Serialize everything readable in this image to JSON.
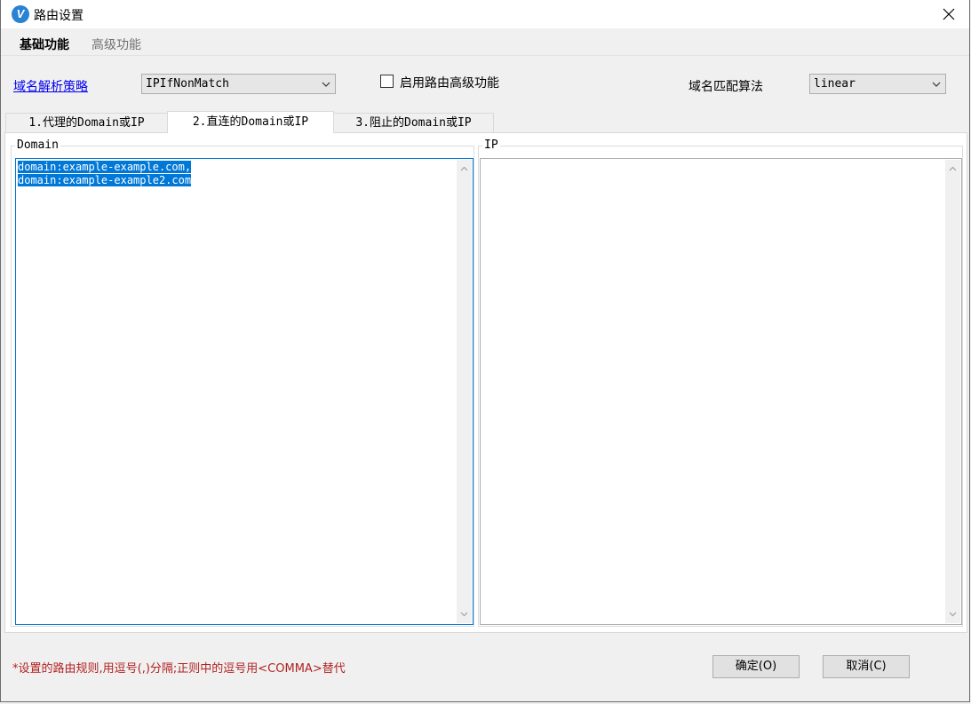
{
  "window": {
    "title": "路由设置",
    "app_icon_letter": "V"
  },
  "menu": {
    "items": [
      {
        "label": "基础功能"
      },
      {
        "label": "高级功能"
      }
    ]
  },
  "options": {
    "domain_strategy_link": "域名解析策略",
    "domain_strategy_value": "IPIfNonMatch",
    "enable_advanced_label": "启用路由高级功能",
    "enable_advanced_checked": false,
    "domain_matcher_label": "域名匹配算法",
    "domain_matcher_value": "linear"
  },
  "tabs": [
    {
      "label": "1.代理的Domain或IP"
    },
    {
      "label": "2.直连的Domain或IP"
    },
    {
      "label": "3.阻止的Domain或IP"
    }
  ],
  "selected_tab_index": 1,
  "panel": {
    "domain_title": "Domain",
    "ip_title": "IP",
    "domain_lines": [
      "domain:example-example.com,",
      "domain:example-example2.com"
    ],
    "ip_lines": []
  },
  "footer": {
    "note": "*设置的路由规则,用逗号(,)分隔;正则中的逗号用<COMMA>替代",
    "ok_label": "确定(O)",
    "cancel_label": "取消(C)"
  },
  "colors": {
    "accent": "#0078d7",
    "link": "#0000ee",
    "note": "#b22222"
  }
}
